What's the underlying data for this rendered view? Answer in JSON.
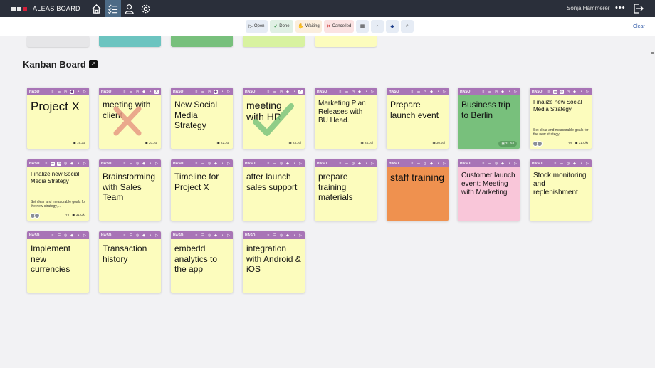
{
  "app": {
    "title": "ALEAS BOARD",
    "user": "Sonja Hammerer"
  },
  "nav": [
    {
      "name": "home-icon",
      "active": false
    },
    {
      "name": "task-list-icon",
      "active": true
    },
    {
      "name": "person-icon",
      "active": false
    },
    {
      "name": "gear-icon",
      "active": false
    }
  ],
  "filters": {
    "open": "Open",
    "done": "Done",
    "waiting": "Waiting",
    "cancelled": "Cancelled",
    "clear": "Clear"
  },
  "board": {
    "title": "Kanban Board"
  },
  "card_tag": "HASO",
  "cards": [
    {
      "title": "Project X",
      "size": "xl",
      "date": "19.Jul",
      "color": "yellow"
    },
    {
      "title": "meeting with client",
      "size": "m",
      "date": "20.Jul",
      "color": "yellow",
      "mark": "cancelled"
    },
    {
      "title": "New Social Media Strategy",
      "size": "m",
      "date": "22.Jul",
      "color": "yellow"
    },
    {
      "title": "meeting with HR",
      "size": "l",
      "date": "23.Jul",
      "color": "yellow",
      "mark": "done"
    },
    {
      "title": "Marketing Plan Releases with BU Head.",
      "size": "s",
      "date": "24.Jul",
      "color": "yellow"
    },
    {
      "title": "Prepare launch event",
      "size": "m",
      "date": "30.Jul",
      "color": "yellow"
    },
    {
      "title": "Business trip to Berlin",
      "size": "m",
      "date": "31.Jul",
      "color": "green"
    },
    {
      "title": "Finalize new Social Media Strategy",
      "size": "xs",
      "desc": "Set clear and measurable goals for the new strategy,...",
      "count": "13",
      "date": "31.Okt",
      "color": "yellow"
    },
    {
      "title": "Finalize new Social Media Strategy",
      "size": "xs",
      "desc": "Set clear and measurable goals for the new strategy,...",
      "count": "13",
      "date": "31.Okt",
      "color": "yellow"
    },
    {
      "title": "Brainstorming  with Sales Team",
      "size": "m",
      "color": "yellow"
    },
    {
      "title": "Timeline for Project X",
      "size": "m",
      "color": "yellow"
    },
    {
      "title": "after launch sales support",
      "size": "m",
      "color": "yellow"
    },
    {
      "title": "prepare training materials",
      "size": "m",
      "color": "yellow"
    },
    {
      "title": "staff training",
      "size": "l",
      "color": "orange"
    },
    {
      "title": "Customer launch event: Meeting with Marketing",
      "size": "s",
      "color": "pink"
    },
    {
      "title": "Stock monitoring and replenishment",
      "size": "s",
      "color": "yellow"
    },
    {
      "title": "Implement new currencies",
      "size": "m",
      "color": "yellow"
    },
    {
      "title": "Transaction history",
      "size": "m",
      "color": "yellow"
    },
    {
      "title": "embedd analytics to the app",
      "size": "m",
      "color": "yellow"
    },
    {
      "title": "integration with Android & iOS",
      "size": "m",
      "color": "yellow"
    }
  ]
}
